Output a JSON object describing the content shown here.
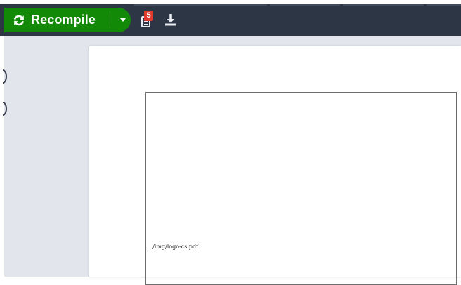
{
  "toolbar": {
    "recompile_label": "Recompile",
    "logs_badge_count": "5",
    "icons": {
      "recompile": "refresh-icon",
      "dropdown": "caret-down-icon",
      "logs": "document-icon",
      "download": "download-icon"
    }
  },
  "pdf_preview": {
    "figure_placeholder_path": "../img/logo-cs.pdf"
  },
  "colors": {
    "toolbar_bg": "#2c3645",
    "recompile_green": "#138a07",
    "badge_red": "#e03a2f",
    "panel_bg": "#e2e5ec"
  }
}
